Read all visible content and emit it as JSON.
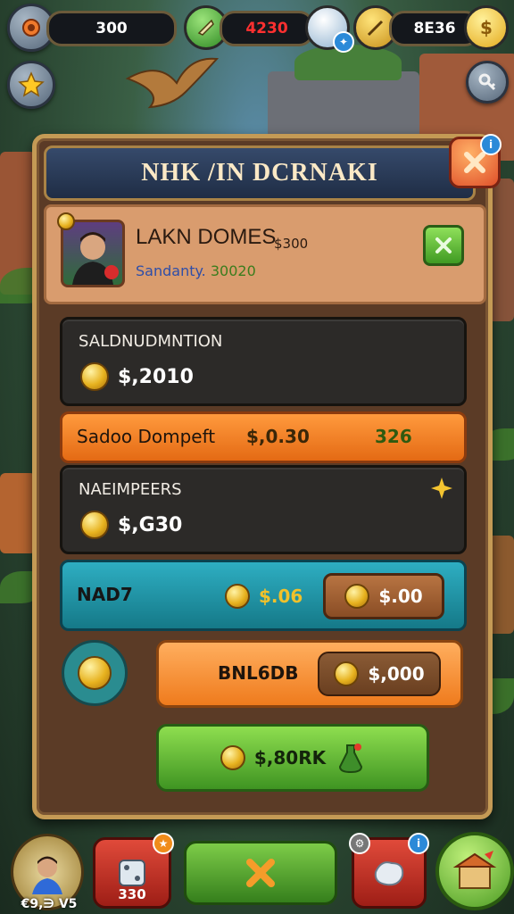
{
  "top_bar": {
    "left_value": "300",
    "middle_value": "4230",
    "right_value": "8E36"
  },
  "panel": {
    "title": "NHK /IN DCRNAKI",
    "profile": {
      "name": "LAKN DOMES",
      "price": "$300",
      "sub_label": "Sandanty.",
      "sub_value": "30020"
    },
    "row1": {
      "label": "SALDNUDMNTION",
      "value": "$,2010"
    },
    "orange_row": {
      "label": "Sadoo Dompeft",
      "value": "$,0.30",
      "extra": "326"
    },
    "row2": {
      "label": "NAEIMPEERS",
      "value": "$,G30"
    },
    "teal_row": {
      "label": "NAD7",
      "mid_value": "$.06",
      "pill_value": "$.00"
    },
    "orange_action": {
      "label": "BNL6DB",
      "pill_value": "$,000"
    },
    "green_button": {
      "label": "$,80RK"
    }
  },
  "bottom_bar": {
    "avatar_value": "€9,∋ V5",
    "box_value": "330"
  },
  "colors": {
    "panel_bg": "#5b3b26",
    "panel_border": "#c49a55",
    "orange": "#f0801f",
    "teal": "#1e96a8",
    "green": "#5bb52f"
  }
}
